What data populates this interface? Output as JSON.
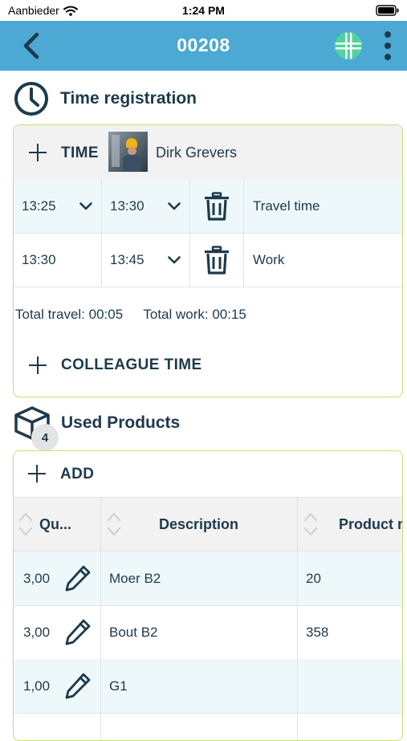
{
  "status_bar": {
    "carrier": "Aanbieder",
    "time": "1:24 PM"
  },
  "header": {
    "title": "00208"
  },
  "time_registration": {
    "title": "Time registration",
    "add_time_label": "TIME",
    "employee_name": "Dirk Grevers",
    "entries": [
      {
        "start": "13:25",
        "end": "13:30",
        "type": "Travel time"
      },
      {
        "start": "13:30",
        "end": "13:45",
        "type": "Work"
      }
    ],
    "totals": {
      "travel": "Total travel: 00:05",
      "work": "Total work: 00:15"
    },
    "colleague_time_label": "COLLEAGUE TIME"
  },
  "used_products": {
    "title": "Used Products",
    "count": "4",
    "add_label": "ADD",
    "columns": [
      "Qu...",
      "Description",
      "Product n"
    ],
    "rows": [
      {
        "quantity": "3,00",
        "description": "Moer B2",
        "product_number": "20"
      },
      {
        "quantity": "3,00",
        "description": "Bout B2",
        "product_number": "358"
      },
      {
        "quantity": "1,00",
        "description": "G1",
        "product_number": ""
      }
    ]
  },
  "colors": {
    "header_bg": "#4ba9d3",
    "card_border": "#c7df6e",
    "text": "#1d3a4c",
    "row_highlight": "#eef8fb",
    "globe": "#4fd39c"
  }
}
